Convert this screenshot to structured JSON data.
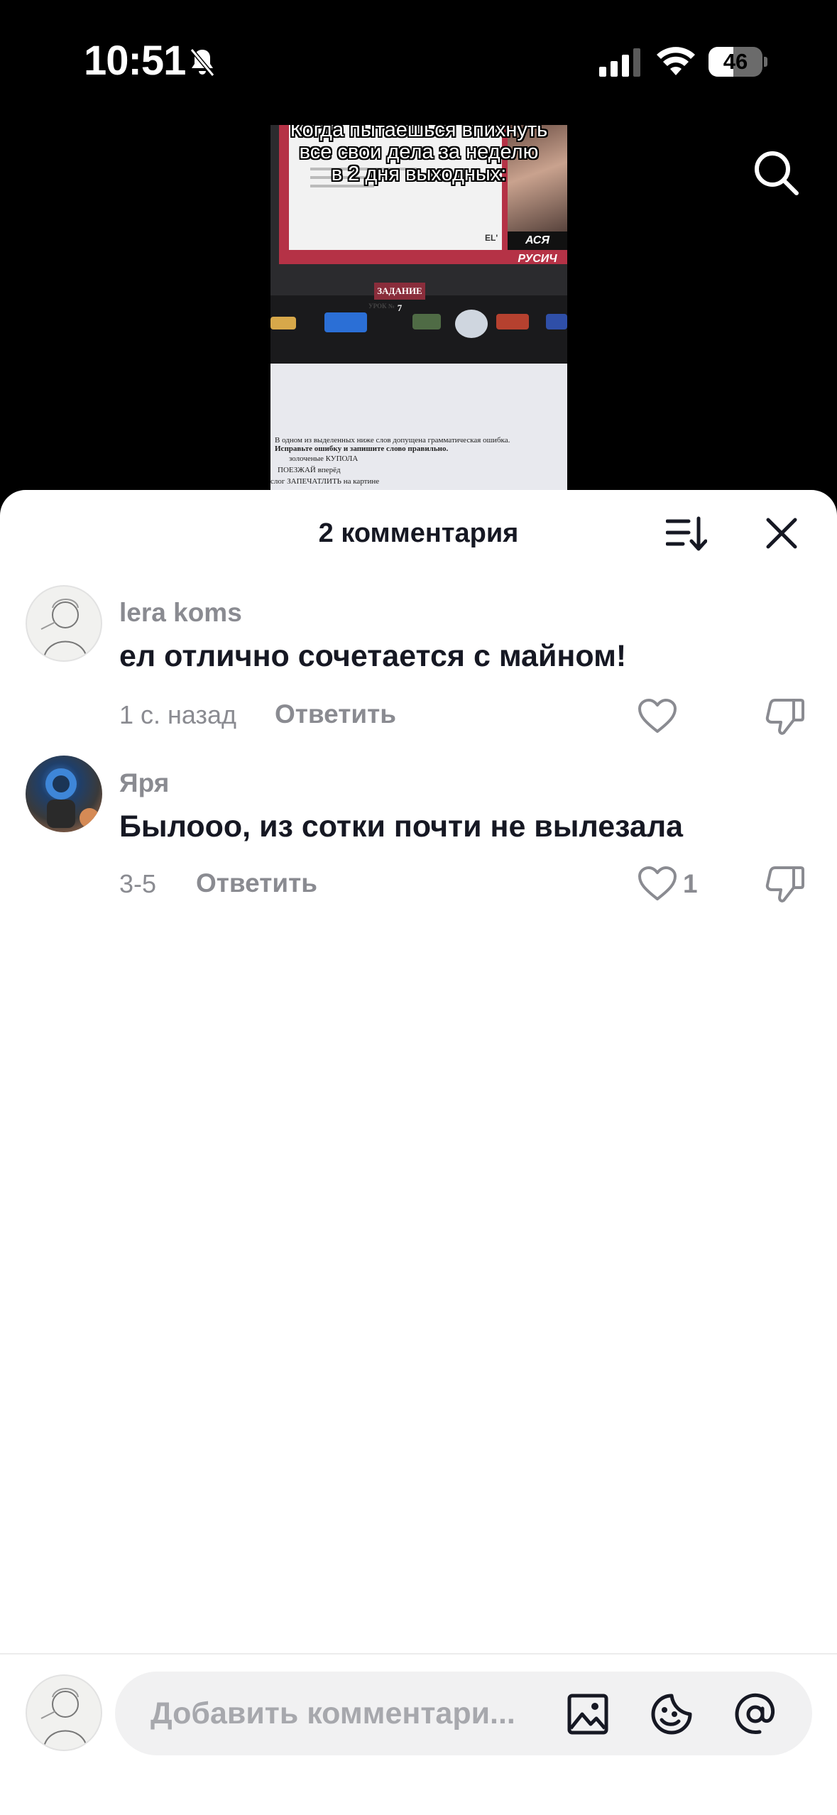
{
  "status_bar": {
    "time": "10:51",
    "battery_percent": 46,
    "battery_label": "46"
  },
  "video": {
    "overlay_text_line1": "Когда пытаешься впихнуть",
    "overlay_text_line2": "все свои дела за неделю",
    "overlay_text_line3": "в 2 дня выходных:",
    "screen_caption": "АСЯ РУСИЧ",
    "screen_logo": "EL'",
    "paper_badge": "ЗАДАНИЕ 7",
    "paper_subtitle": "УРОК №",
    "paper_line1": "В одном из выделенных ниже слов допущена грамматическая ошибка.",
    "paper_line2": "Исправьте ошибку и запишите слово правильно.",
    "paper_line3": "золоченые КУПОЛА",
    "paper_line4": "ПОЕЗЖАЙ вперёд",
    "paper_line5": "слог ЗАПЕЧАТЛИТЬ на картине"
  },
  "sheet": {
    "title": "2 комментария"
  },
  "comments": [
    {
      "username": "lera koms",
      "text": "ел отлично сочетается с майном!",
      "time": "1 с. назад",
      "reply_label": "Ответить",
      "likes": ""
    },
    {
      "username": "Яря",
      "text": "Былооо, из сотки почти не вылезала",
      "time": "3-5",
      "reply_label": "Ответить",
      "likes": "1"
    }
  ],
  "composer": {
    "placeholder": "Добавить комментари..."
  },
  "icons": {
    "bell_off": "bell-slash-icon",
    "search": "search-icon",
    "sort": "sort-icon",
    "close": "close-icon",
    "like": "heart-outline-icon",
    "dislike": "thumbs-down-icon",
    "image": "image-icon",
    "emoji": "emoji-icon",
    "mention": "at-sign-icon"
  },
  "colors": {
    "secondary_text": "#8a8b91",
    "primary_text": "#161823",
    "input_background": "#f1f1f2"
  }
}
